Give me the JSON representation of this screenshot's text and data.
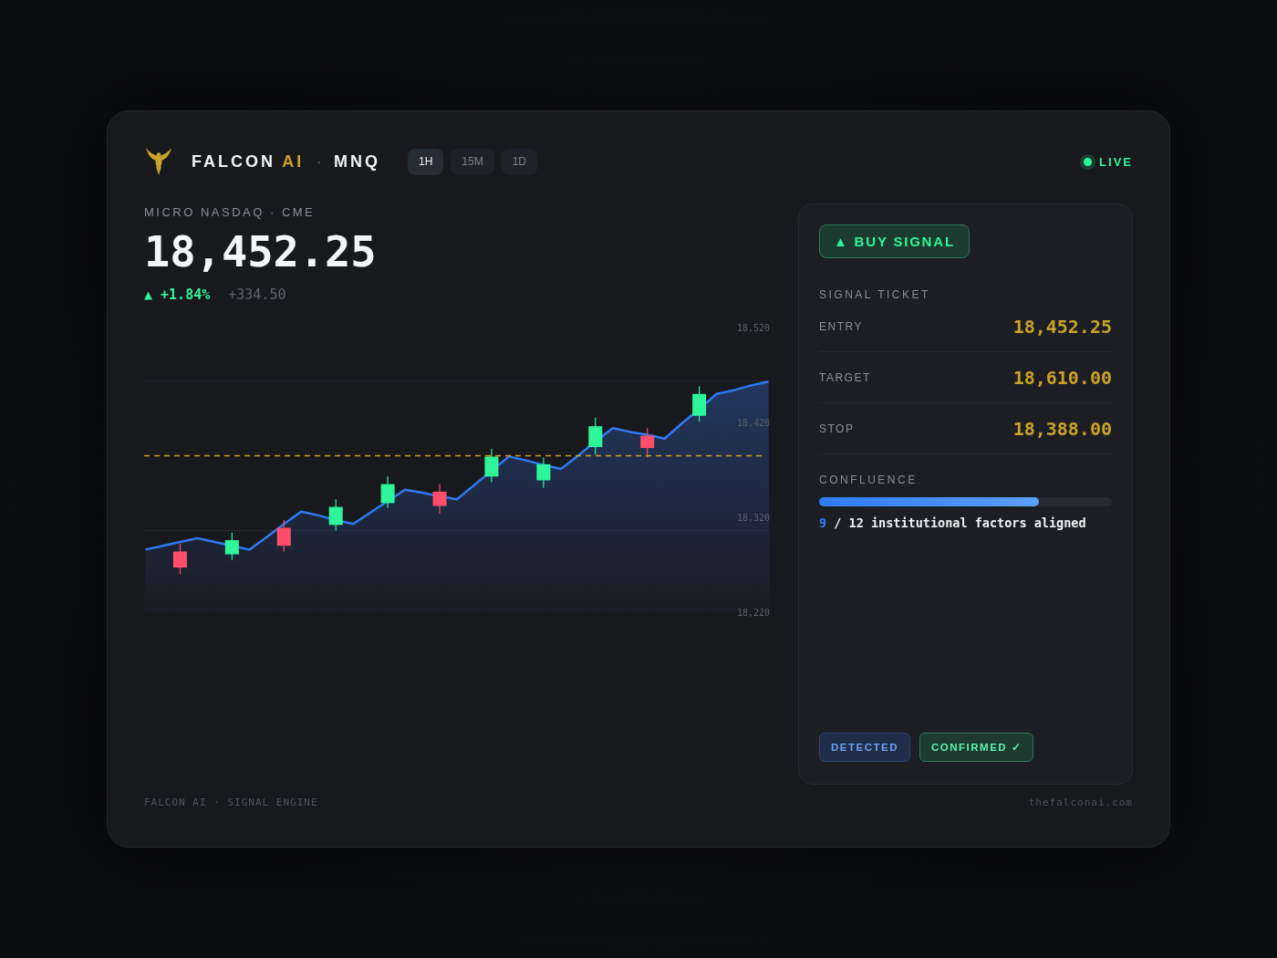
{
  "header": {
    "brand": "FALCON",
    "brand_accent": "AI",
    "separator": "·",
    "symbol": "MNQ",
    "timeframes": [
      {
        "label": "1H",
        "selected": true
      },
      {
        "label": "15M",
        "selected": false
      },
      {
        "label": "1D",
        "selected": false
      }
    ],
    "status": {
      "label": "LIVE",
      "on": true
    }
  },
  "instrument": {
    "name": "MICRO NASDAQ · CME",
    "price": "18,452.25",
    "change_pct": "▲ +1.84%",
    "change_abs": "+334.50",
    "kind": "up"
  },
  "chart": {
    "chart_data": {
      "type": "candlestick",
      "ohlc": [
        null,
        null,
        [
          18284,
          18292,
          18260,
          18267
        ],
        null,
        null,
        [
          18281,
          18304,
          18275,
          18296
        ],
        null,
        null,
        [
          18309,
          18317,
          18284,
          18290
        ],
        null,
        null,
        [
          18312,
          18339,
          18306,
          18331
        ],
        null,
        null,
        [
          18335,
          18363,
          18330,
          18355
        ],
        null,
        null,
        [
          18347,
          18355,
          18324,
          18332
        ],
        null,
        null,
        [
          18363,
          18392,
          18357,
          18384
        ],
        null,
        null,
        [
          18359,
          18383,
          18351,
          18376
        ],
        null,
        null,
        [
          18394,
          18425,
          18386,
          18416
        ],
        null,
        null,
        [
          18406,
          18414,
          18383,
          18393
        ],
        null,
        null,
        [
          18427,
          18458,
          18421,
          18450
        ],
        null,
        null
      ],
      "series": [
        {
          "type": "area",
          "color": "#2f7bf5",
          "values": [
            18286,
            18290,
            18294,
            18298,
            18294,
            18290,
            18286,
            18299,
            18313,
            18326,
            18322,
            18317,
            18313,
            18325,
            18337,
            18349,
            18346,
            18342,
            18339,
            18354,
            18369,
            18384,
            18380,
            18375,
            18371,
            18385,
            18400,
            18414,
            18410,
            18407,
            18403,
            18419,
            18434,
            18450,
            18454,
            18459,
            18463
          ]
        }
      ],
      "ylim": [
        18220,
        18520
      ],
      "yticks": [
        {
          "value": 18520,
          "label": "18,520"
        },
        {
          "value": 18420,
          "label": "18,420"
        },
        {
          "value": 18320,
          "label": "18,320"
        },
        {
          "value": 18220,
          "label": "18,220"
        }
      ],
      "ref_lines": [
        {
          "axis": "y",
          "value": 18464,
          "color": "#262930"
        },
        {
          "axis": "y",
          "value": 18306,
          "color": "#262930"
        },
        {
          "axis": "y",
          "value": 18385,
          "color": "#c9a227"
        }
      ]
    }
  },
  "signal": {
    "badge": "▲ BUY SIGNAL",
    "kind": "up",
    "section_title": "SIGNAL TICKET",
    "rows": [
      {
        "label": "ENTRY",
        "value": "18,452.25"
      },
      {
        "label": "TARGET",
        "value": "18,610.00"
      },
      {
        "label": "STOP",
        "value": "18,388.00"
      }
    ],
    "confluence": {
      "title": "CONFLUENCE",
      "level": 0.75,
      "count": "9",
      "summary": "/ 12 institutional factors aligned"
    },
    "tags": [
      {
        "label": "DETECTED",
        "kind": "detected"
      },
      {
        "label": "CONFIRMED ✓",
        "kind": "confirmed"
      }
    ]
  },
  "footer": {
    "left": "FALCON AI · SIGNAL ENGINE",
    "right": "thefalconai.com"
  }
}
